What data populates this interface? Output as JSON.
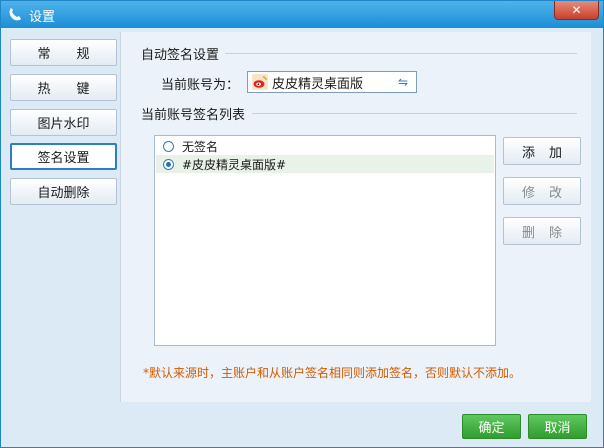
{
  "window": {
    "title": "设置",
    "close_label": "✕"
  },
  "nav": {
    "items": [
      {
        "label": "常　　规"
      },
      {
        "label": "热　　键"
      },
      {
        "label": "图片水印"
      },
      {
        "label": "签名设置",
        "active": true
      },
      {
        "label": "自动删除"
      }
    ]
  },
  "auto_sign": {
    "group_title": "自动签名设置",
    "account_label": "当前账号为：",
    "account_value": "皮皮精灵桌面版",
    "account_icon": "weibo-icon",
    "swap_icon": "⇋"
  },
  "sign_list": {
    "group_title": "当前账号签名列表",
    "items": [
      {
        "label": "无签名",
        "checked": false
      },
      {
        "label": "#皮皮精灵桌面版#",
        "checked": true
      }
    ]
  },
  "actions": {
    "add": "添加",
    "edit": "修改",
    "delete": "删除"
  },
  "note": "*默认来源时，主账户和从账户签名相同则添加签名，否则默认不添加。",
  "footer": {
    "ok": "确定",
    "cancel": "取消"
  },
  "colors": {
    "titlebar": "#1c8ed6",
    "accent": "#2b7fc9",
    "note": "#d35a00",
    "ok_button": "#2f9d2f",
    "close": "#c8402b"
  }
}
